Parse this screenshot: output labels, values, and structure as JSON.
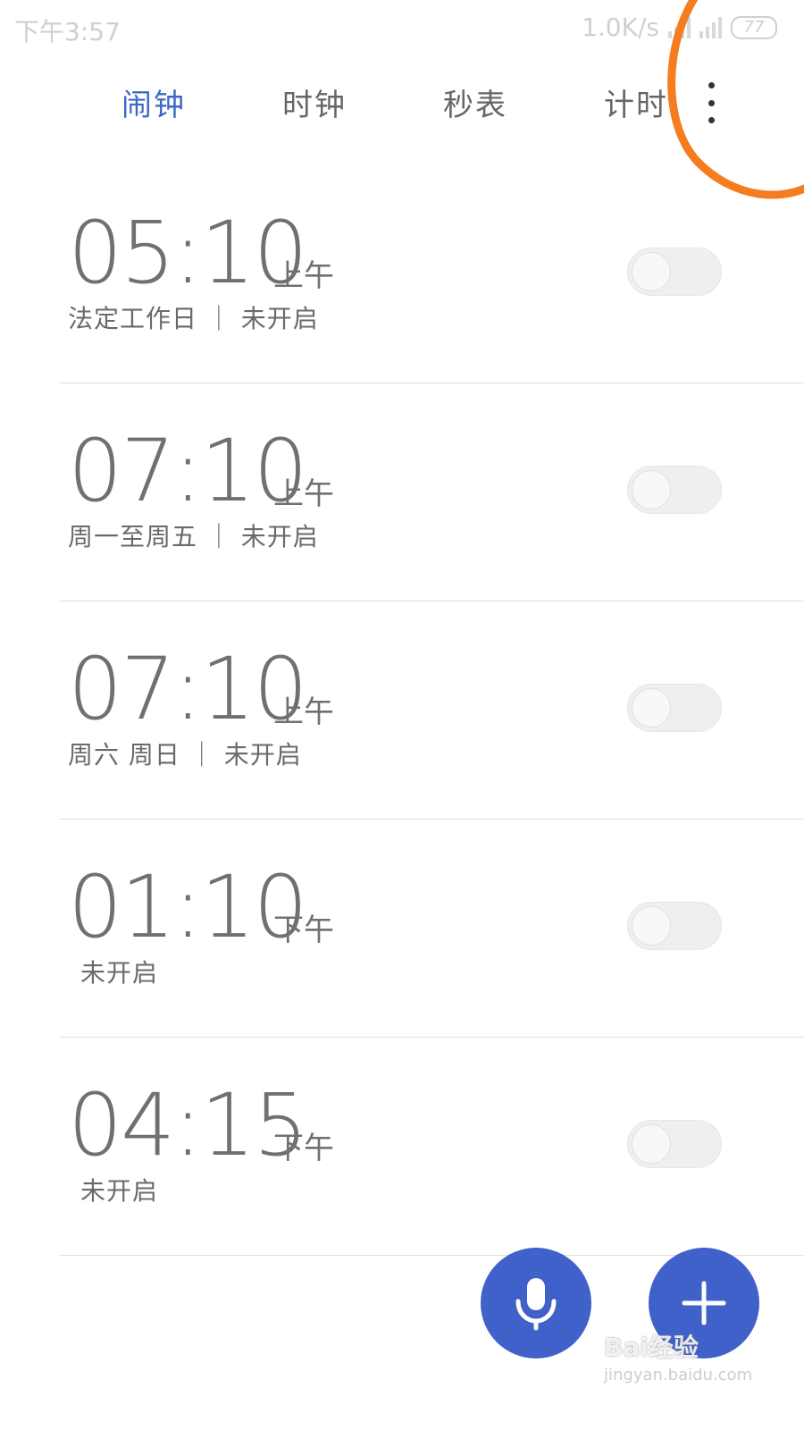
{
  "status_bar": {
    "time": "下午3:57",
    "net_speed": "1.0K/s",
    "battery": "77"
  },
  "tabs": [
    {
      "label": "闹钟",
      "active": true
    },
    {
      "label": "时钟",
      "active": false
    },
    {
      "label": "秒表",
      "active": false
    },
    {
      "label": "计时",
      "active": false
    }
  ],
  "alarms": [
    {
      "time": "05:10",
      "period": "上午",
      "desc": "法定工作日 ｜ 未开启",
      "enabled": false
    },
    {
      "time": "07:10",
      "period": "上午",
      "desc": "周一至周五 ｜ 未开启",
      "enabled": false
    },
    {
      "time": "07:10",
      "period": "上午",
      "desc": "周六 周日 ｜ 未开启",
      "enabled": false
    },
    {
      "time": "01:10",
      "period": "下午",
      "desc": "未开启",
      "enabled": false
    },
    {
      "time": "04:15",
      "period": "下午",
      "desc": "未开启",
      "enabled": false
    }
  ],
  "icons": {
    "more": "more-vert-icon",
    "mic": "microphone-icon",
    "add": "plus-icon"
  },
  "colors": {
    "accent": "#3f68c4",
    "fab": "#3f61c9",
    "annotation": "#f57c1f"
  },
  "watermark": {
    "text": "Bai经验",
    "url": "jingyan.baidu.com"
  }
}
